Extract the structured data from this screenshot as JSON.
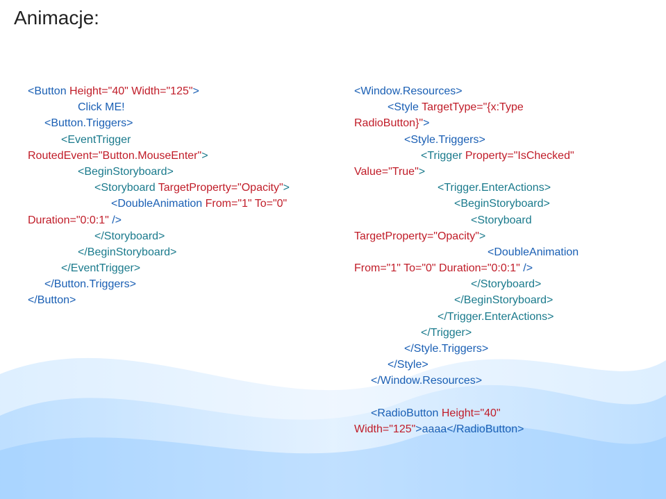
{
  "title": "Animacje:",
  "left": [
    {
      "indent": 0,
      "runs": [
        {
          "c": "blue",
          "t": "<Button"
        },
        {
          "c": "red",
          "t": " Height=\"40\" Width=\"125\""
        },
        {
          "c": "blue",
          "t": ">"
        }
      ]
    },
    {
      "indent": 3,
      "runs": [
        {
          "c": "blue",
          "t": "Click ME!"
        }
      ]
    },
    {
      "indent": 1,
      "runs": [
        {
          "c": "blue",
          "t": "<Button.Triggers>"
        }
      ]
    },
    {
      "indent": 2,
      "runs": [
        {
          "c": "teal",
          "t": "<EventTrigger"
        }
      ]
    },
    {
      "indent": 0,
      "runs": [
        {
          "c": "red",
          "t": "RoutedEvent=\"Button.MouseEnter\""
        },
        {
          "c": "teal",
          "t": ">"
        }
      ]
    },
    {
      "indent": 3,
      "runs": [
        {
          "c": "teal",
          "t": "<BeginStoryboard>"
        }
      ]
    },
    {
      "indent": 4,
      "runs": [
        {
          "c": "teal",
          "t": "<Storyboard "
        },
        {
          "c": "red",
          "t": "TargetProperty=\"Opacity\""
        },
        {
          "c": "teal",
          "t": ">"
        }
      ]
    },
    {
      "indent": 5,
      "runs": [
        {
          "c": "blue",
          "t": "<DoubleAnimation "
        },
        {
          "c": "red",
          "t": "From=\"1\" To=\"0\""
        }
      ]
    },
    {
      "indent": 0,
      "runs": [
        {
          "c": "red",
          "t": "Duration=\"0:0:1\""
        },
        {
          "c": "blue",
          "t": " />"
        }
      ]
    },
    {
      "indent": 4,
      "runs": [
        {
          "c": "teal",
          "t": "</Storyboard>"
        }
      ]
    },
    {
      "indent": 3,
      "runs": [
        {
          "c": "teal",
          "t": "</BeginStoryboard>"
        }
      ]
    },
    {
      "indent": 2,
      "runs": [
        {
          "c": "teal",
          "t": "</EventTrigger>"
        }
      ]
    },
    {
      "indent": 1,
      "runs": [
        {
          "c": "blue",
          "t": "</Button.Triggers>"
        }
      ]
    },
    {
      "indent": 0,
      "runs": [
        {
          "c": "blue",
          "t": "</Button>"
        }
      ]
    }
  ],
  "right": [
    {
      "indent": 0,
      "runs": [
        {
          "c": "blue",
          "t": "<Window.Resources>"
        }
      ]
    },
    {
      "indent": 2,
      "runs": [
        {
          "c": "blue",
          "t": "<Style"
        },
        {
          "c": "red",
          "t": " TargetType=\"{x:Type"
        }
      ]
    },
    {
      "indent": 0,
      "runs": [
        {
          "c": "red",
          "t": "RadioButton}\""
        },
        {
          "c": "blue",
          "t": ">"
        }
      ]
    },
    {
      "indent": 3,
      "runs": [
        {
          "c": "blue",
          "t": "<Style.Triggers>"
        }
      ]
    },
    {
      "indent": 4,
      "runs": [
        {
          "c": "teal",
          "t": "<Trigger"
        },
        {
          "c": "red",
          "t": " Property=\"IsChecked\""
        }
      ]
    },
    {
      "indent": 0,
      "runs": [
        {
          "c": "red",
          "t": "Value=\"True\""
        },
        {
          "c": "teal",
          "t": ">"
        }
      ]
    },
    {
      "indent": 5,
      "runs": [
        {
          "c": "teal",
          "t": "<Trigger.EnterActions>"
        }
      ]
    },
    {
      "indent": 6,
      "runs": [
        {
          "c": "teal",
          "t": "<BeginStoryboard>"
        }
      ]
    },
    {
      "indent": 7,
      "runs": [
        {
          "c": "teal",
          "t": "<Storyboard"
        }
      ]
    },
    {
      "indent": 0,
      "runs": [
        {
          "c": "red",
          "t": "TargetProperty=\"Opacity\""
        },
        {
          "c": "teal",
          "t": ">"
        }
      ]
    },
    {
      "indent": 8,
      "runs": [
        {
          "c": "blue",
          "t": "<DoubleAnimation"
        }
      ]
    },
    {
      "indent": 0,
      "runs": [
        {
          "c": "red",
          "t": "From=\"1\" To=\"0\" Duration=\"0:0:1\""
        },
        {
          "c": "blue",
          "t": " />"
        }
      ]
    },
    {
      "indent": 7,
      "runs": [
        {
          "c": "teal",
          "t": "</Storyboard>"
        }
      ]
    },
    {
      "indent": 6,
      "runs": [
        {
          "c": "teal",
          "t": "</BeginStoryboard>"
        }
      ]
    },
    {
      "indent": 5,
      "runs": [
        {
          "c": "teal",
          "t": "</Trigger.EnterActions>"
        }
      ]
    },
    {
      "indent": 4,
      "runs": [
        {
          "c": "teal",
          "t": "</Trigger>"
        }
      ]
    },
    {
      "indent": 3,
      "runs": [
        {
          "c": "blue",
          "t": "</Style.Triggers>"
        }
      ]
    },
    {
      "indent": 2,
      "runs": [
        {
          "c": "blue",
          "t": "</Style>"
        }
      ]
    },
    {
      "indent": 1,
      "runs": [
        {
          "c": "blue",
          "t": "</Window.Resources>"
        }
      ]
    },
    {
      "indent": 0,
      "runs": [
        {
          "c": "blue",
          "t": " "
        }
      ]
    },
    {
      "indent": 1,
      "runs": [
        {
          "c": "blue",
          "t": "<RadioButton "
        },
        {
          "c": "red",
          "t": "Height=\"40\""
        }
      ]
    },
    {
      "indent": 0,
      "runs": [
        {
          "c": "red",
          "t": "Width=\"125\""
        },
        {
          "c": "blue",
          "t": ">aaaa</RadioButton>"
        }
      ]
    }
  ]
}
